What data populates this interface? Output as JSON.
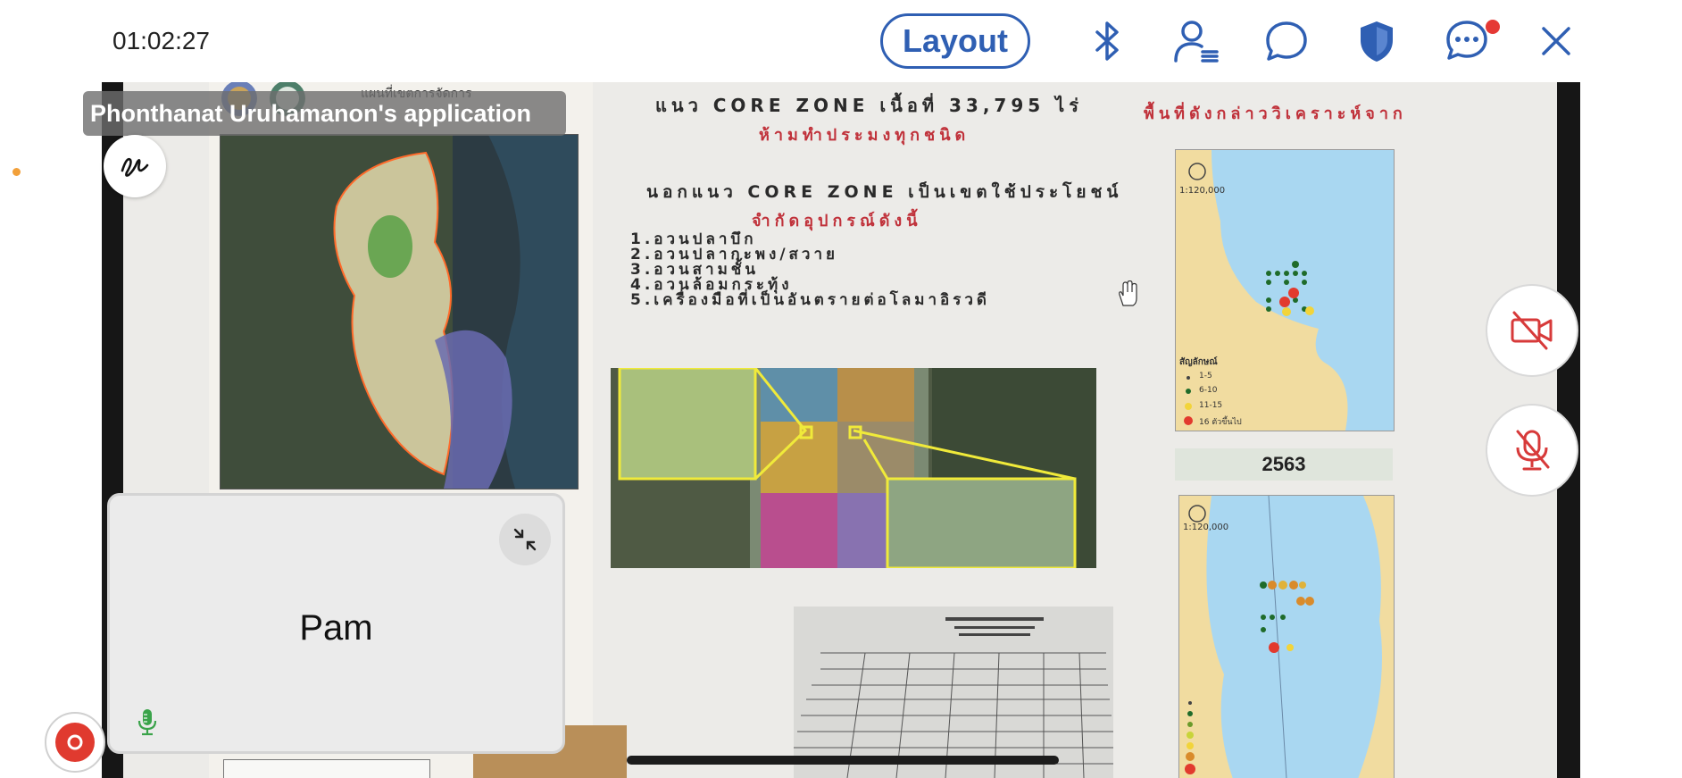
{
  "header": {
    "timer": "01:02:27",
    "layout_label": "Layout",
    "notification_dot_color": "#e53935"
  },
  "share": {
    "app_label": "Phonthanat Uruhamanon's application",
    "slide": {
      "map_title": "แผนที่เขตการจัดการ",
      "line1": "แนว CORE ZONE เนื้อที่ 33,795 ไร่",
      "line2": "ห้ามทำประมงทุกชนิด",
      "line3": "นอกแนว CORE ZONE เป็นเขตใช้ประโยชน์",
      "line4": "จำกัดอุปกรณ์ดังนี้",
      "gear_list": [
        "1.อวนปลาบึก",
        "2.อวนปลากะพง/สวาย",
        "3.อวนสามชั้น",
        "4.อวนล้อมกระทุ้ง",
        "5.เครื่องมือที่เป็นอันตรายต่อโลมาอิรวดี"
      ],
      "right_title": "พื้นที่ดังกล่าววิเคราะห์จาก",
      "scale_top": "1:120,000",
      "scale_bottom": "1:120,000",
      "legend_title": "สัญลักษณ์",
      "legend_items": [
        "1-5",
        "6-10",
        "11-15",
        "16 ตัวขึ้นไป"
      ],
      "year": "2563"
    }
  },
  "self_view": {
    "name": "Pam"
  },
  "colors": {
    "accent": "#2f5fb3",
    "thai_dark": "#2a2a2a",
    "thai_red": "#c0313a",
    "record_red": "#e03a2f",
    "mic_green": "#3aa34a",
    "muted_red": "#d73a3a"
  }
}
